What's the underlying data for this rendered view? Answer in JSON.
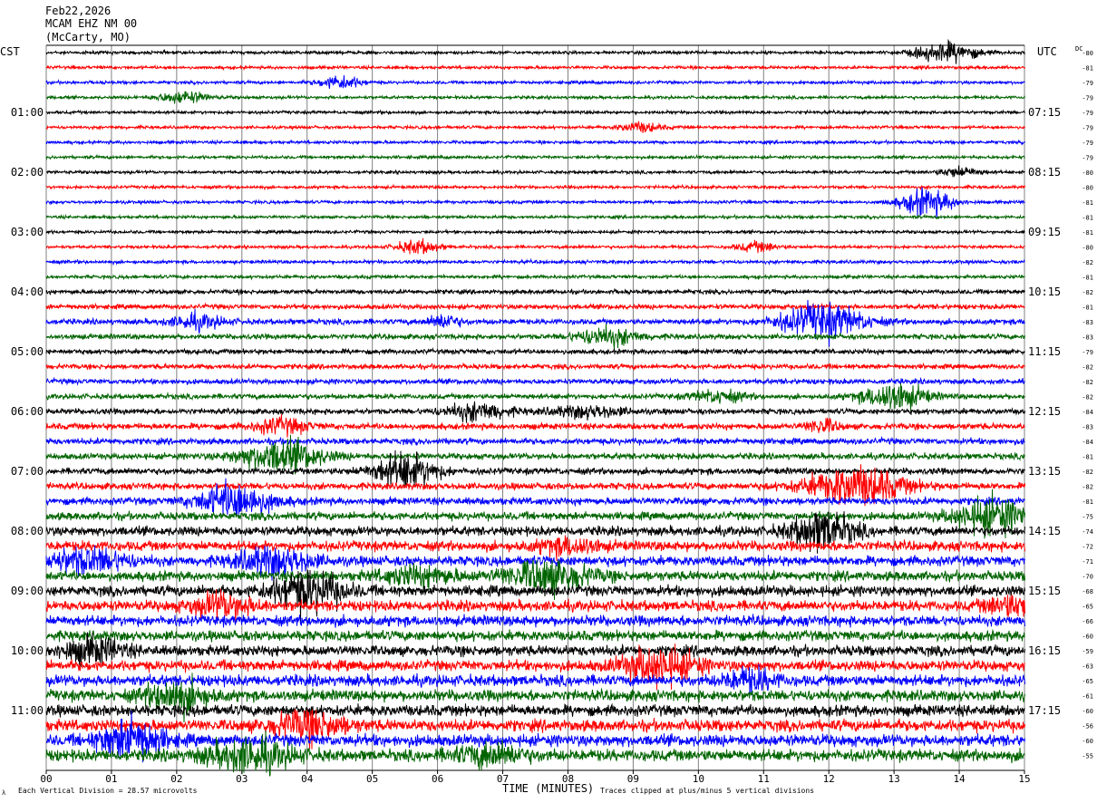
{
  "header": {
    "date": "Feb22,2026",
    "station": "MCAM EHZ NM 00",
    "location": "(McCarty, MO)",
    "left_tz": "CST",
    "right_tz": "UTC",
    "dc_label": "DC"
  },
  "footer": {
    "left_note": "Each Vertical Division = 28.57 microvolts",
    "xlabel": "TIME (MINUTES)",
    "right_note": "Traces clipped at plus/minus 5 vertical divisions",
    "corner_mark": "λ"
  },
  "colors": {
    "trace_cycle": [
      "#000000",
      "#ff0000",
      "#0000ff",
      "#006400"
    ],
    "grid": "#808080",
    "background": "#ffffff"
  },
  "chart_data": {
    "type": "line",
    "subtype": "helicorder",
    "xlabel": "TIME (MINUTES)",
    "xlim": [
      0,
      15
    ],
    "x_ticks": [
      "00",
      "01",
      "02",
      "03",
      "04",
      "05",
      "06",
      "07",
      "08",
      "09",
      "10",
      "11",
      "12",
      "13",
      "14",
      "15"
    ],
    "minutes_per_line": 15,
    "line_count": 48,
    "left_time_labels": [
      {
        "line": 4,
        "label": "01:00"
      },
      {
        "line": 8,
        "label": "02:00"
      },
      {
        "line": 12,
        "label": "03:00"
      },
      {
        "line": 16,
        "label": "04:00"
      },
      {
        "line": 20,
        "label": "05:00"
      },
      {
        "line": 24,
        "label": "06:00"
      },
      {
        "line": 28,
        "label": "07:00"
      },
      {
        "line": 32,
        "label": "08:00"
      },
      {
        "line": 36,
        "label": "09:00"
      },
      {
        "line": 40,
        "label": "10:00"
      },
      {
        "line": 44,
        "label": "11:00"
      }
    ],
    "right_time_labels": [
      {
        "line": 4,
        "label": "07:15"
      },
      {
        "line": 8,
        "label": "08:15"
      },
      {
        "line": 12,
        "label": "09:15"
      },
      {
        "line": 16,
        "label": "10:15"
      },
      {
        "line": 20,
        "label": "11:15"
      },
      {
        "line": 24,
        "label": "12:15"
      },
      {
        "line": 28,
        "label": "13:15"
      },
      {
        "line": 32,
        "label": "14:15"
      },
      {
        "line": 36,
        "label": "15:15"
      },
      {
        "line": 40,
        "label": "16:15"
      },
      {
        "line": 44,
        "label": "17:15"
      }
    ],
    "dc_offsets": [
      "-80",
      "-81",
      "-79",
      "-79",
      "-79",
      "-79",
      "-79",
      "-79",
      "-80",
      "-80",
      "-81",
      "-81",
      "-81",
      "-80",
      "-82",
      "-81",
      "-82",
      "-81",
      "-83",
      "-83",
      "-79",
      "-82",
      "-82",
      "-82",
      "-84",
      "-83",
      "-84",
      "-81",
      "-82",
      "-82",
      "-81",
      "-75",
      "-74",
      "-72",
      "-71",
      "-70",
      "-68",
      "-65",
      "-66",
      "-60",
      "-59",
      "-63",
      "-65",
      "-61",
      "-60",
      "-56",
      "-60",
      "-55"
    ],
    "noise_levels": [
      1.0,
      1.0,
      1.0,
      1.0,
      1.0,
      1.0,
      1.0,
      1.0,
      1.0,
      1.0,
      1.0,
      1.0,
      1.0,
      1.0,
      1.1,
      1.1,
      1.4,
      1.6,
      1.8,
      1.7,
      1.6,
      1.6,
      1.7,
      1.7,
      1.8,
      2.0,
      2.0,
      2.0,
      2.1,
      2.2,
      2.4,
      2.6,
      3.0,
      3.2,
      3.2,
      3.2,
      3.4,
      3.4,
      3.4,
      3.3,
      3.4,
      3.4,
      3.6,
      3.6,
      3.6,
      3.8,
      3.8,
      3.8
    ],
    "events": [
      {
        "line": 0,
        "minute": 13.8,
        "amp": 10,
        "dur": 0.6
      },
      {
        "line": 2,
        "minute": 4.5,
        "amp": 7,
        "dur": 0.4
      },
      {
        "line": 3,
        "minute": 2.1,
        "amp": 6,
        "dur": 0.5
      },
      {
        "line": 5,
        "minute": 9.1,
        "amp": 5,
        "dur": 0.4
      },
      {
        "line": 8,
        "minute": 14.0,
        "amp": 5,
        "dur": 0.4
      },
      {
        "line": 10,
        "minute": 13.5,
        "amp": 14,
        "dur": 0.5
      },
      {
        "line": 13,
        "minute": 5.7,
        "amp": 7,
        "dur": 0.4
      },
      {
        "line": 13,
        "minute": 10.9,
        "amp": 5,
        "dur": 0.4
      },
      {
        "line": 18,
        "minute": 11.9,
        "amp": 18,
        "dur": 0.8
      },
      {
        "line": 18,
        "minute": 2.3,
        "amp": 7,
        "dur": 0.5
      },
      {
        "line": 18,
        "minute": 6.1,
        "amp": 7,
        "dur": 0.3
      },
      {
        "line": 19,
        "minute": 8.6,
        "amp": 9,
        "dur": 0.6
      },
      {
        "line": 23,
        "minute": 13.0,
        "amp": 14,
        "dur": 0.6
      },
      {
        "line": 23,
        "minute": 10.3,
        "amp": 6,
        "dur": 0.5
      },
      {
        "line": 24,
        "minute": 6.6,
        "amp": 9,
        "dur": 0.6
      },
      {
        "line": 24,
        "minute": 8.3,
        "amp": 6,
        "dur": 0.7
      },
      {
        "line": 25,
        "minute": 3.6,
        "amp": 8,
        "dur": 0.5
      },
      {
        "line": 25,
        "minute": 11.9,
        "amp": 7,
        "dur": 0.3
      },
      {
        "line": 27,
        "minute": 3.6,
        "amp": 16,
        "dur": 0.8
      },
      {
        "line": 28,
        "minute": 5.5,
        "amp": 18,
        "dur": 0.6
      },
      {
        "line": 29,
        "minute": 12.4,
        "amp": 20,
        "dur": 0.9
      },
      {
        "line": 30,
        "minute": 2.9,
        "amp": 18,
        "dur": 0.7
      },
      {
        "line": 31,
        "minute": 14.5,
        "amp": 18,
        "dur": 0.7
      },
      {
        "line": 32,
        "minute": 11.9,
        "amp": 20,
        "dur": 0.6
      },
      {
        "line": 33,
        "minute": 8.0,
        "amp": 8,
        "dur": 0.6
      },
      {
        "line": 34,
        "minute": 0.6,
        "amp": 12,
        "dur": 0.8
      },
      {
        "line": 34,
        "minute": 3.5,
        "amp": 14,
        "dur": 0.7
      },
      {
        "line": 35,
        "minute": 7.7,
        "amp": 16,
        "dur": 0.8
      },
      {
        "line": 35,
        "minute": 5.7,
        "amp": 9,
        "dur": 0.7
      },
      {
        "line": 36,
        "minute": 4.0,
        "amp": 20,
        "dur": 0.7
      },
      {
        "line": 37,
        "minute": 2.7,
        "amp": 12,
        "dur": 0.6
      },
      {
        "line": 37,
        "minute": 14.8,
        "amp": 10,
        "dur": 0.5
      },
      {
        "line": 40,
        "minute": 0.7,
        "amp": 12,
        "dur": 0.6
      },
      {
        "line": 41,
        "minute": 9.4,
        "amp": 18,
        "dur": 0.7
      },
      {
        "line": 42,
        "minute": 10.8,
        "amp": 10,
        "dur": 0.5
      },
      {
        "line": 43,
        "minute": 2.0,
        "amp": 16,
        "dur": 0.6
      },
      {
        "line": 45,
        "minute": 4.0,
        "amp": 14,
        "dur": 0.7
      },
      {
        "line": 46,
        "minute": 1.3,
        "amp": 20,
        "dur": 0.6
      },
      {
        "line": 47,
        "minute": 3.1,
        "amp": 16,
        "dur": 0.8
      },
      {
        "line": 47,
        "minute": 6.8,
        "amp": 10,
        "dur": 0.7
      }
    ]
  }
}
